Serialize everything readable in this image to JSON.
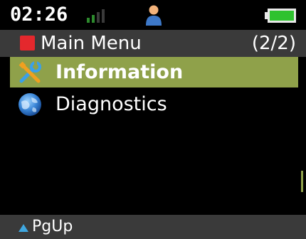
{
  "status": {
    "time": "02:26",
    "signal_icon": "signal-bars-icon",
    "user_icon": "user-icon",
    "battery_icon": "battery-icon",
    "battery_fraction": 0.85
  },
  "header": {
    "title": "Main Menu",
    "page_indicator": "(2/2)",
    "accent_color": "#e4282d"
  },
  "menu": {
    "items": [
      {
        "label": "Information",
        "icon": "tools-icon",
        "selected": true
      },
      {
        "label": "Diagnostics",
        "icon": "globe-icon",
        "selected": false
      }
    ],
    "selection_color": "#8fa14a"
  },
  "footer": {
    "page_up_label": "PgUp",
    "arrow_icon": "triangle-up-icon"
  }
}
